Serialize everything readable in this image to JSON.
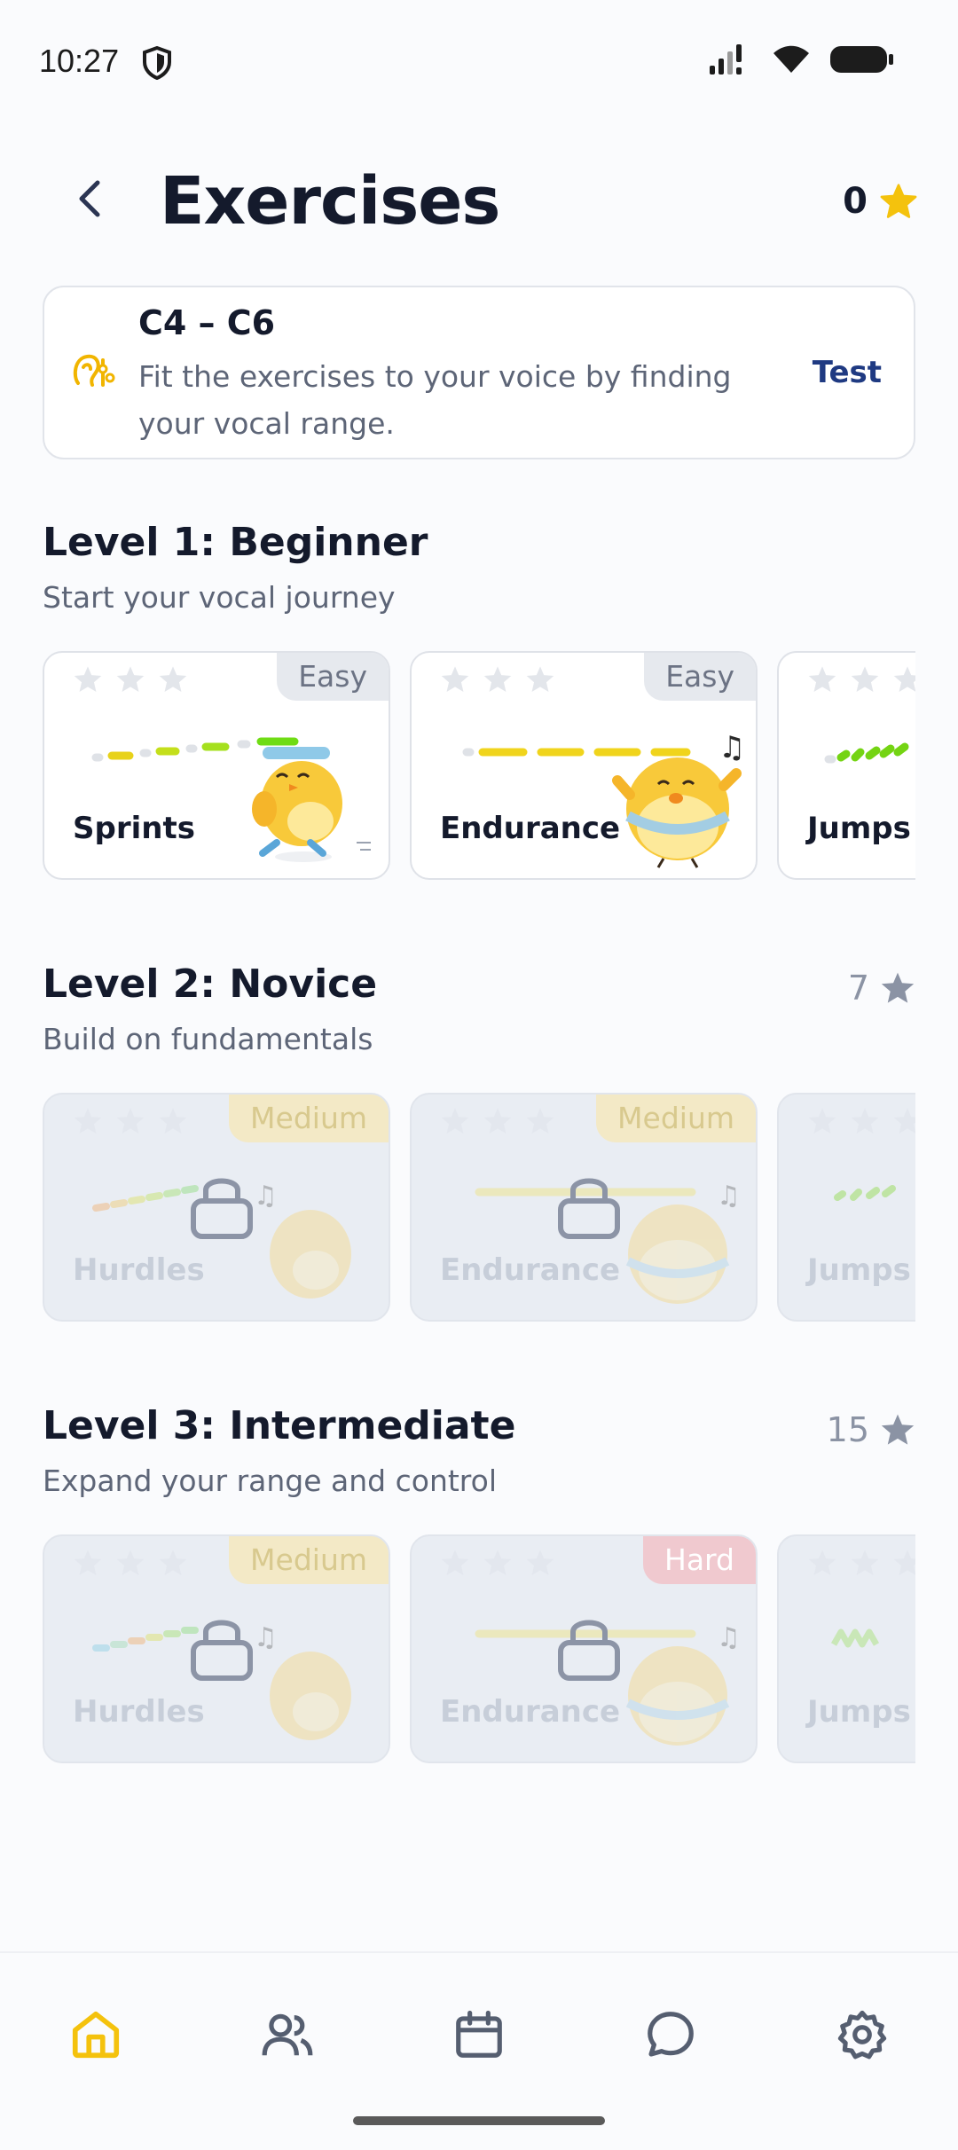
{
  "status": {
    "time": "10:27"
  },
  "header": {
    "title": "Exercises",
    "stars": "0"
  },
  "range_card": {
    "range": "C4 – C6",
    "description": "Fit the exercises to your voice by finding your vocal range.",
    "action": "Test"
  },
  "levels": [
    {
      "title": "Level 1: Beginner",
      "subtitle": "Start your vocal journey",
      "required_stars": "",
      "exercises": [
        {
          "name": "Sprints",
          "difficulty": "Easy",
          "locked": false
        },
        {
          "name": "Endurance",
          "difficulty": "Easy",
          "locked": false
        },
        {
          "name": "Jumps",
          "difficulty": "",
          "locked": false
        }
      ]
    },
    {
      "title": "Level 2: Novice",
      "subtitle": "Build on fundamentals",
      "required_stars": "7",
      "exercises": [
        {
          "name": "Hurdles",
          "difficulty": "Medium",
          "locked": true
        },
        {
          "name": "Endurance",
          "difficulty": "Medium",
          "locked": true
        },
        {
          "name": "Jumps",
          "difficulty": "",
          "locked": true
        }
      ]
    },
    {
      "title": "Level 3: Intermediate",
      "subtitle": "Expand your range and control",
      "required_stars": "15",
      "exercises": [
        {
          "name": "Hurdles",
          "difficulty": "Medium",
          "locked": true
        },
        {
          "name": "Endurance",
          "difficulty": "Hard",
          "locked": true
        },
        {
          "name": "Jumps",
          "difficulty": "",
          "locked": true
        }
      ]
    }
  ],
  "nav": {
    "items": [
      "home-icon",
      "people-icon",
      "calendar-icon",
      "chat-icon",
      "settings-icon"
    ],
    "active": "home-icon"
  },
  "colors": {
    "accent": "#f4c20d",
    "easy_badge": "#e6e9ee",
    "medium_badge": "#f3e9c6",
    "hard_badge": "#f0c9cf",
    "link": "#1f3a82"
  }
}
